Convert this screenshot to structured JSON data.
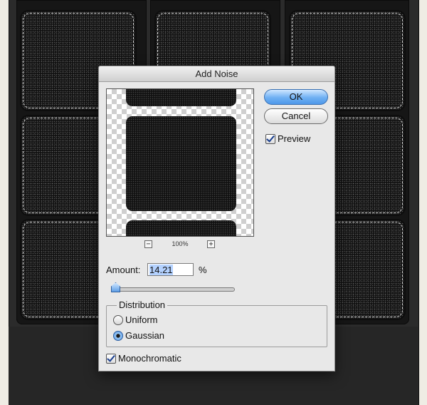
{
  "dialog": {
    "title": "Add Noise",
    "ok_label": "OK",
    "cancel_label": "Cancel",
    "preview_label": "Preview",
    "preview_checked": true,
    "zoom_out_symbol": "−",
    "zoom_in_symbol": "+",
    "zoom_level": "100%",
    "amount_label": "Amount:",
    "amount_value": "14.21",
    "amount_unit": "%",
    "distribution_title": "Distribution",
    "distribution_options": [
      {
        "label": "Uniform",
        "selected": false
      },
      {
        "label": "Gaussian",
        "selected": true
      }
    ],
    "monochromatic_label": "Monochromatic",
    "monochromatic_checked": true
  },
  "colors": {
    "accent": "#4e98ea",
    "canvas": "#2b2b2b"
  },
  "icons": [
    "checkmark-icon",
    "zoom-out-icon",
    "zoom-in-icon",
    "slider-thumb-icon"
  ]
}
